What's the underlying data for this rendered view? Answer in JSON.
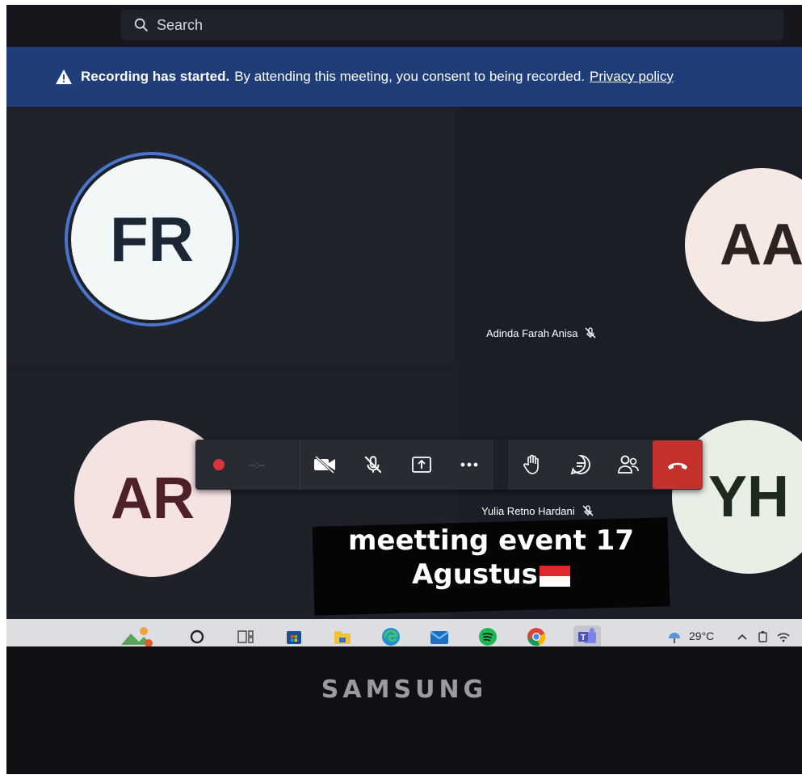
{
  "search": {
    "placeholder": "Search"
  },
  "banner": {
    "strong": "Recording has started.",
    "text": "By attending this meeting, you consent to being recorded.",
    "link": "Privacy policy"
  },
  "participants": [
    {
      "initials": "FR",
      "name": ""
    },
    {
      "initials": "AA",
      "name": "Adinda Farah Anisa"
    },
    {
      "initials": "AR",
      "name": ""
    },
    {
      "initials": "YH",
      "name": "Yulia Retno Hardani"
    }
  ],
  "controls": {
    "recording_time": "--:--",
    "icons": [
      "record-icon",
      "camera-off-icon",
      "mic-off-icon",
      "share-icon",
      "more-icon",
      "raise-hand-icon",
      "chat-icon",
      "people-icon",
      "hang-up-icon"
    ]
  },
  "caption": {
    "line1": "meetting event 17",
    "line2": "Agustus"
  },
  "taskbar": {
    "icons": [
      "widgets-icon",
      "search-icon",
      "task-view-icon",
      "store-icon",
      "file-explorer-icon",
      "edge-icon",
      "mail-icon",
      "spotify-icon",
      "chrome-icon",
      "teams-icon"
    ],
    "temperature": "29°C"
  },
  "bezel": {
    "brand": "SAMSUNG"
  },
  "colors": {
    "banner": "#1f3d78",
    "hangup": "#c4312d",
    "speaking_ring": "#4b75cc",
    "background": "#1c1f27"
  }
}
